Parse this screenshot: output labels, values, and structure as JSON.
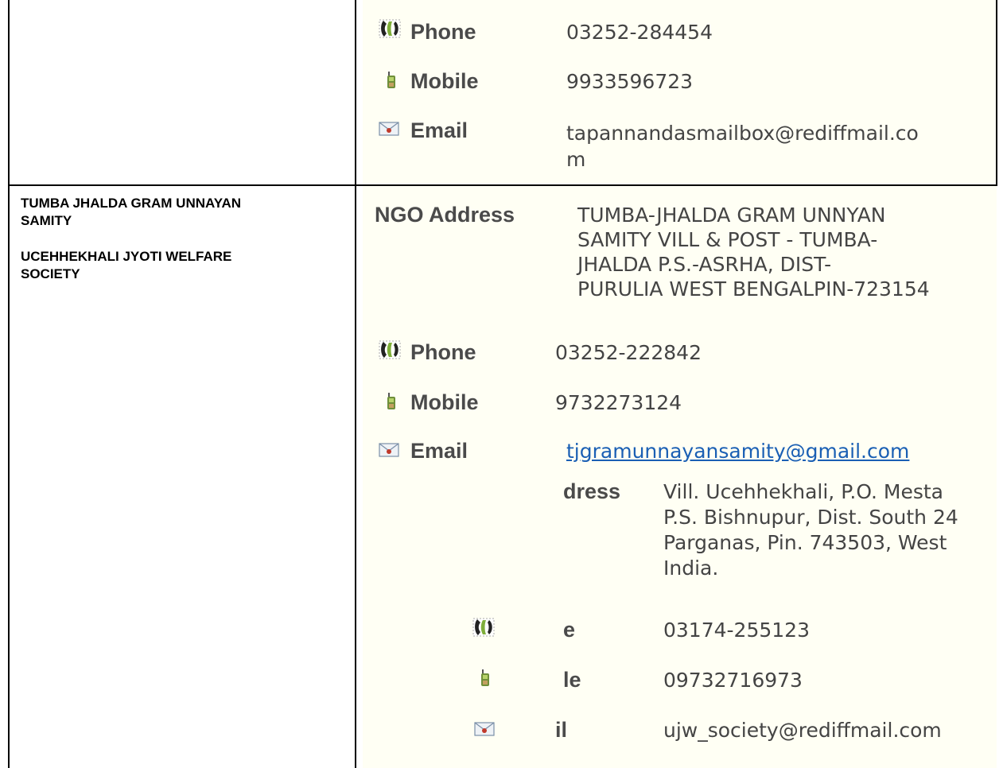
{
  "colors": {
    "panel_bg": "#fffff4",
    "label": "#4a4a4a",
    "value": "#444444",
    "link": "#1a5fb4"
  },
  "entries": [
    {
      "phone_label": "Phone",
      "phone": "03252-284454",
      "mobile_label": "Mobile",
      "mobile": "9933596723",
      "email_label": "Email",
      "email_line1": "tapannandasmailbox@rediffmail.co",
      "email_line2": "m"
    },
    {
      "org_line1": "TUMBA JHALDA GRAM UNNAYAN",
      "org_line2": "SAMITY",
      "address_label": "NGO Address",
      "address_lines": [
        "TUMBA-JHALDA GRAM UNNYAN",
        "SAMITY VILL & POST - TUMBA-",
        "JHALDA P.S.-ASRHA, DIST-",
        "PURULIA WEST BENGALPIN-723154"
      ],
      "phone_label": "Phone",
      "phone": "03252-222842",
      "mobile_label": "Mobile",
      "mobile": "9732273124",
      "email_label": "Email",
      "email": "tjgramunnayansamity@gmail.com"
    },
    {
      "org_line1": "UCEHHEKHALI JYOTI WELFARE",
      "org_line2": "SOCIETY",
      "address_label": "dress",
      "address_lines": [
        "Vill. Ucehhekhali, P.O. Mesta",
        "P.S. Bishnupur, Dist. South 24",
        "Parganas, Pin. 743503, West",
        "India."
      ],
      "phone_label": "e",
      "phone": "03174-255123",
      "mobile_label": "le",
      "mobile": "09732716973",
      "email_label": "il",
      "email": "ujw_society@rediffmail.com"
    }
  ]
}
